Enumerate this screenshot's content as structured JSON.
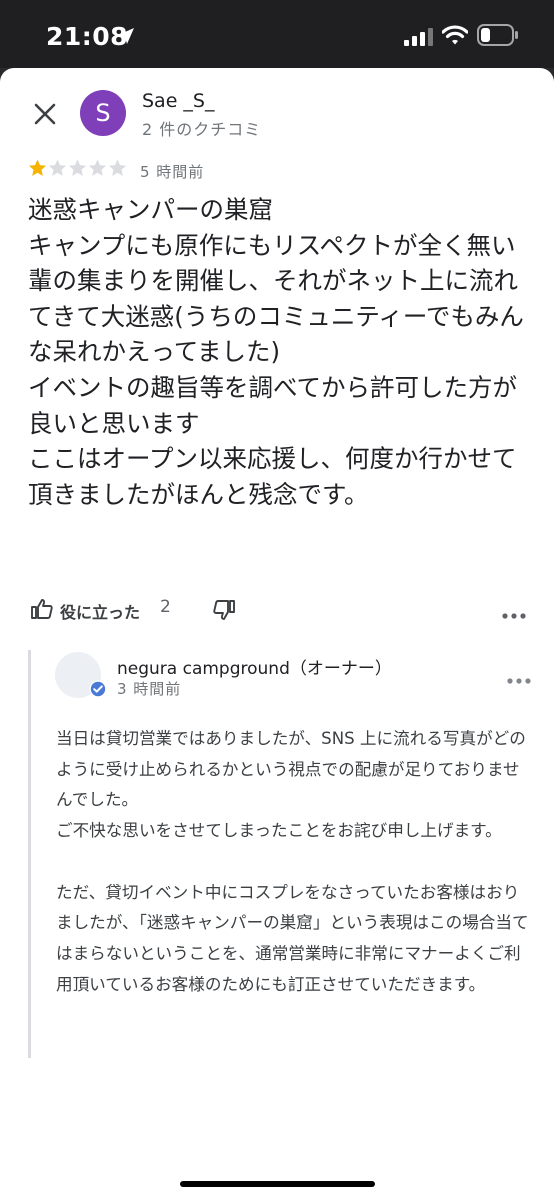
{
  "status_bar": {
    "time": "21:08",
    "icons": [
      "location-arrow-icon",
      "cellular-signal-icon",
      "wifi-icon",
      "battery-icon"
    ]
  },
  "review": {
    "avatar_letter": "S",
    "avatar_color": "#7e3fb8",
    "reviewer_name": "Sae _S_",
    "review_count": "2 件のクチコミ",
    "rating": 1,
    "max_rating": 5,
    "time": "5 時間前",
    "text": "迷惑キャンパーの巣窟\nキャンプにも原作にもリスペクトが全く無い輩の集まりを開催し、それがネット上に流れてきて大迷惑(うちのコミュニティーでもみんな呆れかえってました)\nイベントの趣旨等を調べてから許可した方が良いと思います\nここはオープン以来応援し、何度か行かせて頂きましたがほんと残念です。",
    "helpful_label": "役に立った",
    "helpful_count": "2"
  },
  "owner_reply": {
    "owner_name": "negura campground（オーナー）",
    "time": "3 時間前",
    "verified_color": "#4a7ad6",
    "text": "当日は貸切営業ではありましたが、SNS 上に流れる写真がどのように受け止められるかという視点での配慮が足りておりませんでした。\nご不快な思いをさせてしまったことをお詫び申し上げます。\n\nただ、貸切イベント中にコスプレをなさっていたお客様はおりましたが、「迷惑キャンパーの巣窟」という表現はこの場合当てはまらないということを、通常営業時に非常にマナーよくご利用頂いているお客様のためにも訂正させていただきます。"
  },
  "colors": {
    "star_filled": "#f4b400",
    "star_empty": "#dadce0",
    "text_primary": "#202124",
    "text_secondary": "#70757a"
  }
}
